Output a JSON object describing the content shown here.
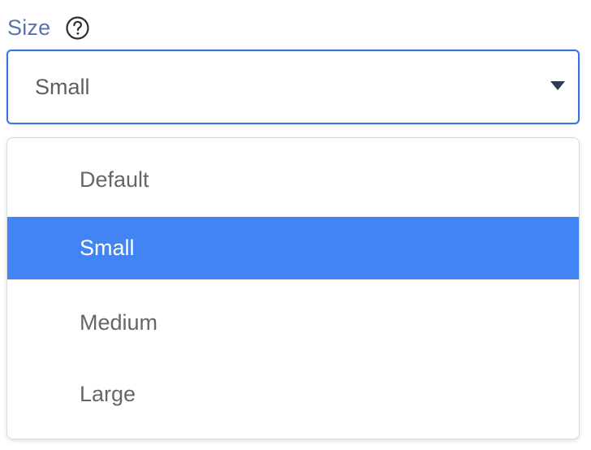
{
  "field": {
    "label": "Size",
    "help_icon": "question-circle-icon",
    "selected_value": "Small",
    "caret_icon": "caret-down-icon"
  },
  "dropdown": {
    "options": [
      {
        "label": "Default",
        "selected": false
      },
      {
        "label": "Small",
        "selected": true
      },
      {
        "label": "Medium",
        "selected": false
      },
      {
        "label": "Large",
        "selected": false
      }
    ]
  },
  "colors": {
    "label": "#5a73ad",
    "select_border": "#3b72e0",
    "selected_option_bg": "#4384f5",
    "selected_option_text": "#ffffff",
    "option_text": "#666666",
    "caret": "#2f3b55"
  }
}
